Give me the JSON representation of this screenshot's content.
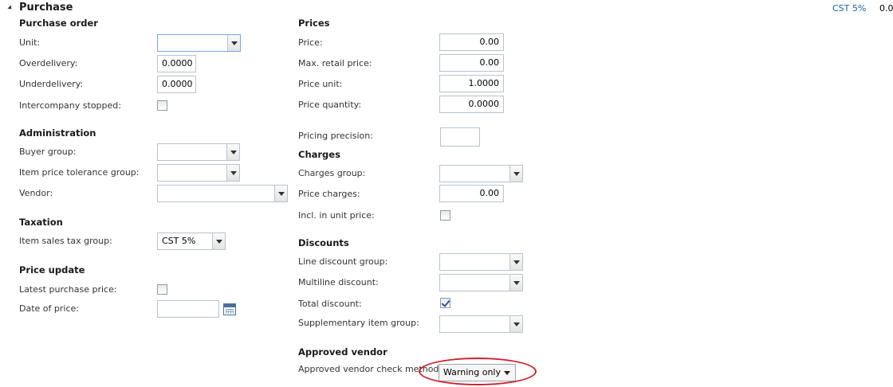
{
  "header": {
    "title": "Purchase",
    "summary_link": "CST 5%",
    "summary_value": "0.0"
  },
  "left": {
    "purchase_order": {
      "title": "Purchase order",
      "unit_label": "Unit:",
      "unit_value": "",
      "overdelivery_label": "Overdelivery:",
      "overdelivery_value": "0.0000",
      "underdelivery_label": "Underdelivery:",
      "underdelivery_value": "0.0000",
      "intercompany_stopped_label": "Intercompany stopped:",
      "intercompany_stopped_checked": false
    },
    "administration": {
      "title": "Administration",
      "buyer_group_label": "Buyer group:",
      "buyer_group_value": "",
      "price_tolerance_label": "Item price tolerance group:",
      "price_tolerance_value": "",
      "vendor_label": "Vendor:",
      "vendor_value": ""
    },
    "taxation": {
      "title": "Taxation",
      "item_sales_tax_label": "Item sales tax group:",
      "item_sales_tax_value": "CST 5%"
    },
    "price_update": {
      "title": "Price update",
      "latest_purchase_price_label": "Latest purchase price:",
      "latest_purchase_price_checked": false,
      "date_of_price_label": "Date of price:",
      "date_of_price_value": ""
    }
  },
  "right": {
    "prices": {
      "title": "Prices",
      "price_label": "Price:",
      "price_value": "0.00",
      "max_retail_label": "Max. retail price:",
      "max_retail_value": "0.00",
      "price_unit_label": "Price unit:",
      "price_unit_value": "1.0000",
      "price_quantity_label": "Price quantity:",
      "price_quantity_value": "0.0000",
      "pricing_precision_label": "Pricing precision:",
      "pricing_precision_value": ""
    },
    "charges": {
      "title": "Charges",
      "charges_group_label": "Charges group:",
      "charges_group_value": "",
      "price_charges_label": "Price charges:",
      "price_charges_value": "0.00",
      "incl_unit_price_label": "Incl. in unit price:",
      "incl_unit_price_checked": false
    },
    "discounts": {
      "title": "Discounts",
      "line_discount_label": "Line discount group:",
      "line_discount_value": "",
      "multiline_discount_label": "Multiline discount:",
      "multiline_discount_value": "",
      "total_discount_label": "Total discount:",
      "total_discount_checked": true,
      "supplementary_label": "Supplementary item group:",
      "supplementary_value": ""
    },
    "approved_vendor": {
      "title": "Approved vendor",
      "check_method_label": "Approved vendor check method:",
      "check_method_value": "Warning only"
    }
  },
  "colors": {
    "accent_link": "#1e5fb4",
    "highlight": "#d0202a",
    "field_border": "#b9c3cf"
  }
}
